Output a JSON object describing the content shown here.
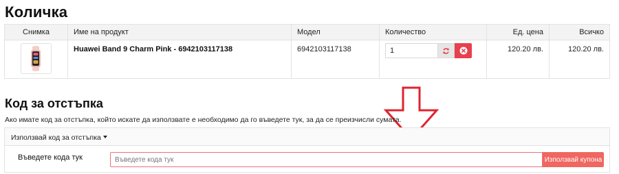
{
  "cart": {
    "title": "Количка",
    "columns": {
      "image": "Снимка",
      "name": "Име на продукт",
      "model": "Модел",
      "quantity": "Количество",
      "unit_price": "Ед. цена",
      "total": "Всичко"
    },
    "items": [
      {
        "name": "Huawei Band 9 Charm Pink - 6942103117138",
        "model": "6942103117138",
        "quantity": "1",
        "unit_price": "120.20 лв.",
        "total": "120.20 лв."
      }
    ]
  },
  "coupon": {
    "title": "Код за отстъпка",
    "description": "Ако имате код за отстъпка, който искате да използвате е необходимо да го въведете тук, за да се преизчисли сумата.",
    "toggle_label": "Използвай код за отстъпка",
    "field_label": "Въведете кода тук",
    "placeholder": "Въведете кода тук",
    "button_label": "Използвай купона"
  },
  "colors": {
    "accent": "#f06660",
    "remove": "#e8404e",
    "arrow": "#e0232e"
  },
  "icons": {
    "refresh": "refresh-icon",
    "remove": "remove-circle-icon",
    "caret": "caret-down-icon",
    "arrow": "down-arrow-icon"
  }
}
